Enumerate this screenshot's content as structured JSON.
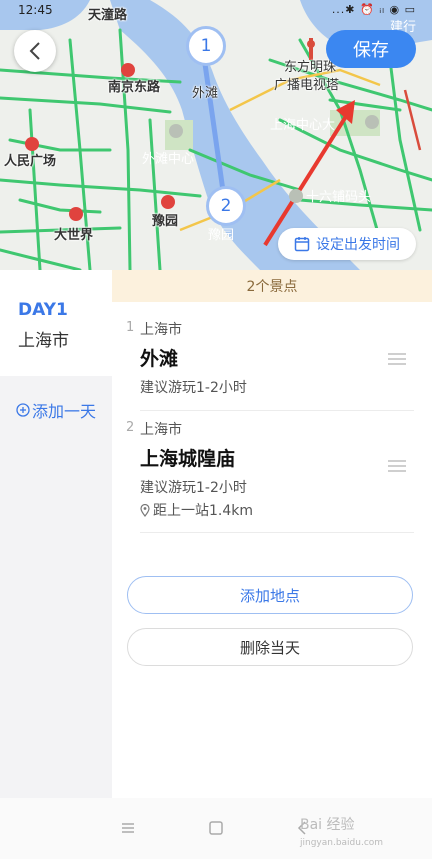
{
  "status_bar": {
    "time": "12:45",
    "icons": "...✱ ⏰ ᵢₗ ◉ ▭"
  },
  "map": {
    "labels": {
      "tianchi_road": "天潼路",
      "nanjing_east": "南京东路",
      "bund": "外滩",
      "oriental_pearl": "东方明珠",
      "broadcast_tower": "广播电视塔",
      "shanghai_center": "上海中心大",
      "peoples_square": "人民广场",
      "bund_center": "外滩中心",
      "shiliupu": "十六铺码头",
      "yuyuan": "豫园",
      "da_shijie": "大世界",
      "yuyuan_poi": "豫园",
      "jianshe": "建行"
    },
    "back_icon": "chevron-left-icon",
    "save_label": "保存",
    "depart_label": "设定出发时间",
    "depart_icon": "calendar-icon",
    "markers": [
      "1",
      "2"
    ]
  },
  "day_column": {
    "day_title": "DAY1",
    "day_city": "上海市",
    "add_day_label": "添加一天",
    "add_day_icon": "plus-circle-icon"
  },
  "list": {
    "banner": "2个景点",
    "spots": [
      {
        "num": "1",
        "city": "上海市",
        "name": "外滩",
        "duration": "建议游玩1-2小时"
      },
      {
        "num": "2",
        "city": "上海市",
        "name": "上海城隍庙",
        "duration": "建议游玩1-2小时",
        "distance": "距上一站1.4km",
        "distance_icon": "location-pin-icon"
      }
    ],
    "add_place_label": "添加地点",
    "delete_day_label": "删除当天"
  },
  "nav_bar": {
    "menu_icon": "menu-icon",
    "home_icon": "home-square-icon",
    "back_icon": "back-triangle-icon",
    "watermark": "Bai 经验",
    "watermark_sub": "jingyan.baidu.com"
  },
  "colors": {
    "accent": "#3b87f1",
    "road_green": "#3fc770",
    "water": "#a8c7ee",
    "banner_bg": "#fcf1dd",
    "arrow_red": "#e8392f"
  }
}
